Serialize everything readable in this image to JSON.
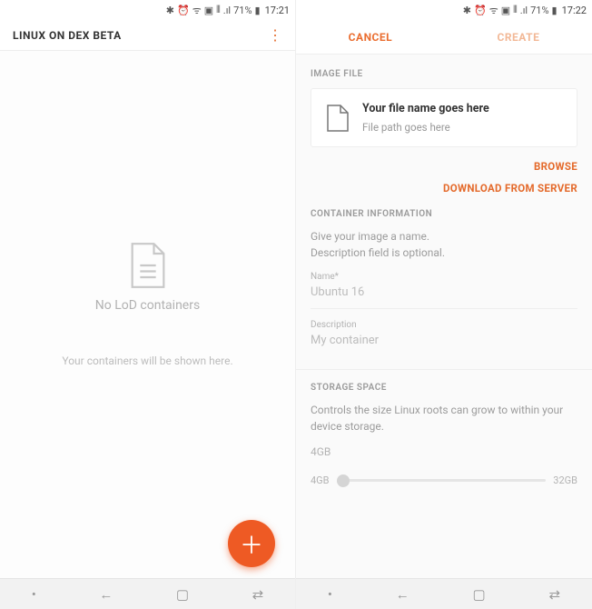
{
  "left": {
    "status": {
      "battery": "71%",
      "time": "17:21"
    },
    "title": "LINUX ON DEX BETA",
    "empty_title": "No LoD containers",
    "empty_sub": "Your containers will be shown here."
  },
  "right": {
    "status": {
      "battery": "71%",
      "time": "17:22"
    },
    "actions": {
      "cancel": "CANCEL",
      "create": "CREATE"
    },
    "section_image": "IMAGE FILE",
    "file": {
      "name": "Your file name goes here",
      "path": "File path goes here"
    },
    "links": {
      "browse": "BROWSE",
      "download": "DOWNLOAD FROM SERVER"
    },
    "section_info": "CONTAINER INFORMATION",
    "info_help1": "Give your image a name.",
    "info_help2": "Description field is optional.",
    "name_label": "Name*",
    "name_value": "Ubuntu 16",
    "desc_label": "Description",
    "desc_value": "My container",
    "section_storage": "STORAGE SPACE",
    "storage_help": "Controls the size Linux roots can grow to within your device storage.",
    "storage_value": "4GB",
    "slider_min": "4GB",
    "slider_max": "32GB"
  }
}
